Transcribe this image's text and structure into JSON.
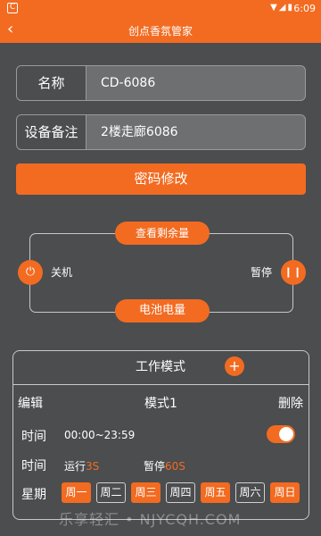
{
  "status": {
    "time": "6:09",
    "icons": "▼◢▮"
  },
  "app_bar": {
    "back_icon": "chevron-left-icon",
    "title": "创点香氛管家"
  },
  "device": {
    "name_label": "名称",
    "name_value": "CD-6086",
    "note_label": "设备备注",
    "note_value": "2楼走廊6086"
  },
  "password_button": "密码修改",
  "control": {
    "remaining_label": "查看剩余量",
    "power_label": "关机",
    "pause_label": "暂停",
    "battery_label": "电池电量",
    "power_icon": "⏻",
    "pause_icon": "❙❙"
  },
  "work_mode": {
    "title": "工作模式",
    "add_icon": "+",
    "edit_label": "编辑",
    "mode_name": "模式1",
    "delete_label": "删除",
    "time_label": "时间",
    "time_range": "00:00~23:59",
    "time_toggle_on": true,
    "run_label": "时间",
    "run_prefix": "运行",
    "run_value": "3S",
    "pause_prefix": "暂停",
    "pause_value": "60S",
    "week_label": "星期",
    "days": [
      {
        "label": "周一",
        "on": true
      },
      {
        "label": "周二",
        "on": false
      },
      {
        "label": "周三",
        "on": true
      },
      {
        "label": "周四",
        "on": false
      },
      {
        "label": "周五",
        "on": true
      },
      {
        "label": "周六",
        "on": false
      },
      {
        "label": "周日",
        "on": true
      }
    ]
  },
  "watermark": "乐享轻汇 • NJYCQH.COM",
  "colors": {
    "accent": "#f26b21",
    "background": "#4b4d4f"
  }
}
